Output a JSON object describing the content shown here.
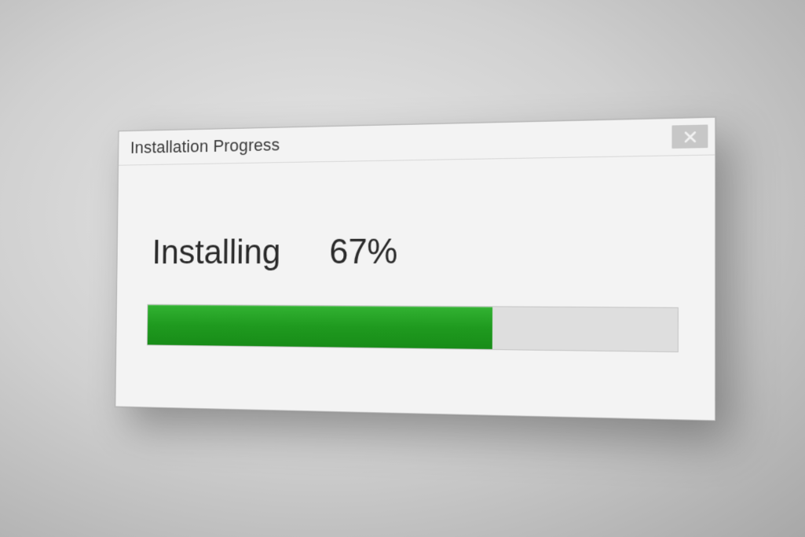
{
  "dialog": {
    "title": "Installation Progress",
    "status_label": "Installing",
    "percent_text": "67%",
    "percent_value": 67,
    "colors": {
      "progress_fill": "#1f9a1f",
      "progress_track": "#dedede",
      "window_bg": "#f3f3f3"
    }
  }
}
